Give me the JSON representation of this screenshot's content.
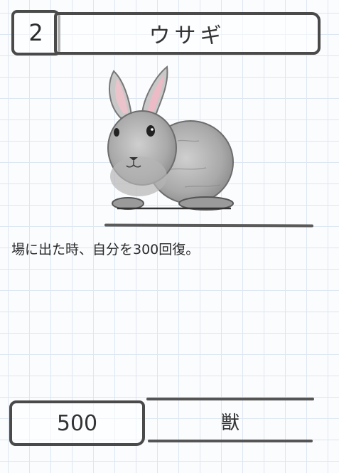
{
  "card": {
    "cost": "2",
    "name": "ウサギ",
    "effect": "場に出た時、自分を300回復。",
    "hp": "500",
    "type": "獣",
    "art": "rabbit-illustration"
  },
  "colors": {
    "border": "#4a4a4a",
    "grid": "#dde6f1",
    "background": "#fbfcfe",
    "ear_inner": "#f2b8c4"
  }
}
